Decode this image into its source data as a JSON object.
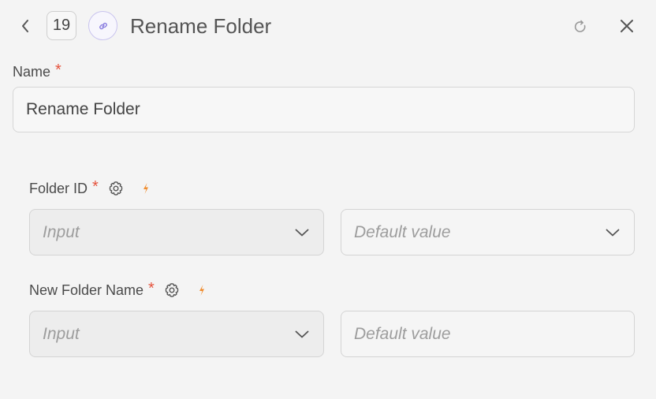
{
  "header": {
    "step_number": "19",
    "title": "Rename Folder",
    "icons": {
      "back": "chevron-left-icon",
      "node": "link-icon",
      "refresh": "refresh-icon",
      "close": "close-icon"
    }
  },
  "name_field": {
    "label": "Name",
    "required_mark": "*",
    "value": "Rename Folder"
  },
  "params": [
    {
      "label": "Folder ID",
      "required_mark": "*",
      "input_placeholder": "Input",
      "default_placeholder": "Default value"
    },
    {
      "label": "New Folder Name",
      "required_mark": "*",
      "input_placeholder": "Input",
      "default_placeholder": "Default value"
    }
  ],
  "colors": {
    "required": "#e5533d",
    "bolt": "#f08c2e",
    "node_icon": "#8b7fe0"
  }
}
